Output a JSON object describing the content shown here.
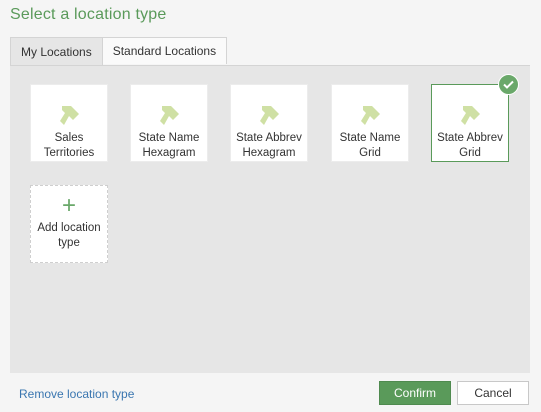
{
  "dialog": {
    "title": "Select a location type"
  },
  "tabs": [
    {
      "label": "My Locations",
      "active": true
    },
    {
      "label": "Standard Locations",
      "active": false
    }
  ],
  "location_types": [
    {
      "line1": "Sales",
      "line2": "Territories",
      "icon": "location-pin-icon",
      "selected": false
    },
    {
      "line1": "State Name",
      "line2": "Hexagram",
      "icon": "location-pin-icon",
      "selected": false
    },
    {
      "line1": "State Abbrev",
      "line2": "Hexagram",
      "icon": "location-pin-icon",
      "selected": false
    },
    {
      "line1": "State Name",
      "line2": "Grid",
      "icon": "location-pin-icon",
      "selected": false
    },
    {
      "line1": "State Abbrev",
      "line2": "Grid",
      "icon": "location-pin-icon",
      "selected": true
    }
  ],
  "add_card": {
    "line1": "Add location",
    "line2": "type",
    "icon": "plus-icon"
  },
  "footer": {
    "remove_link": "Remove location type",
    "confirm_label": "Confirm",
    "cancel_label": "Cancel"
  },
  "colors": {
    "accent": "#5a9a5a",
    "icon_fill": "#cfe0a4",
    "link": "#3a76b0"
  }
}
